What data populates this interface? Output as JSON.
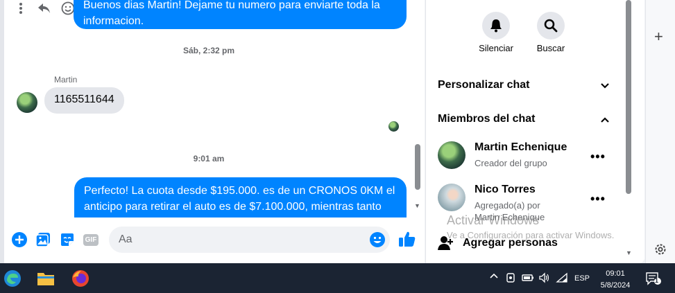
{
  "chat": {
    "outgoing_top": "Buenos dias Martin! Dejame tu numero para enviarte toda la informacion.",
    "timestamp_1": "Sáb, 2:32 pm",
    "sender_name": "Martin",
    "incoming_message": "1165511644",
    "timestamp_2": "9:01 am",
    "outgoing_bottom": "Perfecto! La cuota desde $195.000. es de un CRONOS 0KM el anticipo para retirar el auto es de $7.100.000, mientras tanto"
  },
  "composer": {
    "placeholder": "Aa",
    "gif_label": "GIF"
  },
  "panel": {
    "mute_label": "Silenciar",
    "search_label": "Buscar",
    "customize_label": "Personalizar chat",
    "members_label": "Miembros del chat",
    "members": [
      {
        "name": "Martin Echenique",
        "role": "Creador del grupo"
      },
      {
        "name": "Nico Torres",
        "role": "Agregado(a) por Martin Echenique"
      }
    ],
    "more_label": "•••",
    "add_people_label": "Agregar personas"
  },
  "watermark": {
    "title": "Activar Windows",
    "subtitle": "Ve a Configuración para activar Windows."
  },
  "taskbar": {
    "language": "ESP",
    "time": "09:01",
    "date": "5/8/2024",
    "notification_count": "1"
  },
  "colors": {
    "messenger_blue": "#0084ff",
    "incoming_bubble": "#e4e6eb",
    "taskbar_bg": "#1b2433"
  }
}
